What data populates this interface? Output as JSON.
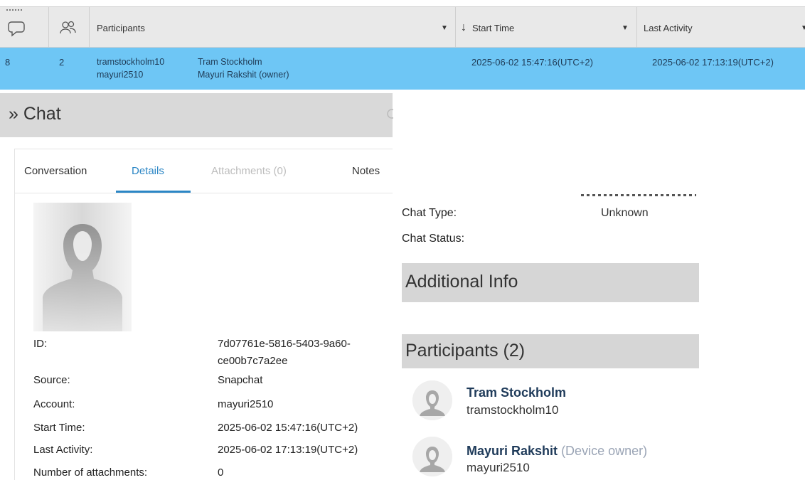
{
  "grid": {
    "headers": {
      "participants": "Participants",
      "start_time": "Start Time",
      "last_activity": "Last Activity",
      "sort_arrow": "↓"
    },
    "row": {
      "messages": "8",
      "participants_count": "2",
      "usernames": [
        "tramstockholm10",
        "mayuri2510"
      ],
      "names": [
        "Tram Stockholm",
        "Mayuri Rakshit (owner)"
      ],
      "start_time": "2025-06-02 15:47:16(UTC+2)",
      "last_activity": "2025-06-02 17:13:19(UTC+2)"
    },
    "row_color": "#6ec6f5"
  },
  "chat": {
    "title": "» Chat",
    "tabs": [
      "Conversation",
      "Details",
      "Attachments (0)",
      "Notes"
    ],
    "active_tab": "Details",
    "accent": "#2b86c5",
    "details": [
      {
        "label": "ID:",
        "value": "7d07761e-5816-5403-9a60-",
        "value2": "ce00b7c7a2ee"
      },
      {
        "label": "Source:",
        "value": "Snapchat"
      },
      {
        "label": "Account:",
        "value": "mayuri2510"
      },
      {
        "label": "Start Time:",
        "value": "2025-06-02 15:47:16(UTC+2)"
      },
      {
        "label": "Last Activity:",
        "value": "2025-06-02 17:13:19(UTC+2)"
      },
      {
        "label": "Number of attachments:",
        "value": "0"
      }
    ]
  },
  "info": {
    "chat_type_label": "Chat Type:",
    "chat_type_value": "Unknown",
    "chat_status_label": "Chat Status:",
    "additional_info_title": "Additional Info",
    "participants_title": "Participants (2)",
    "participants": [
      {
        "name": "Tram Stockholm",
        "username": "tramstockholm10",
        "role": ""
      },
      {
        "name": "Mayuri Rakshit",
        "username": "mayuri2510",
        "role": "(Device owner)"
      }
    ]
  }
}
